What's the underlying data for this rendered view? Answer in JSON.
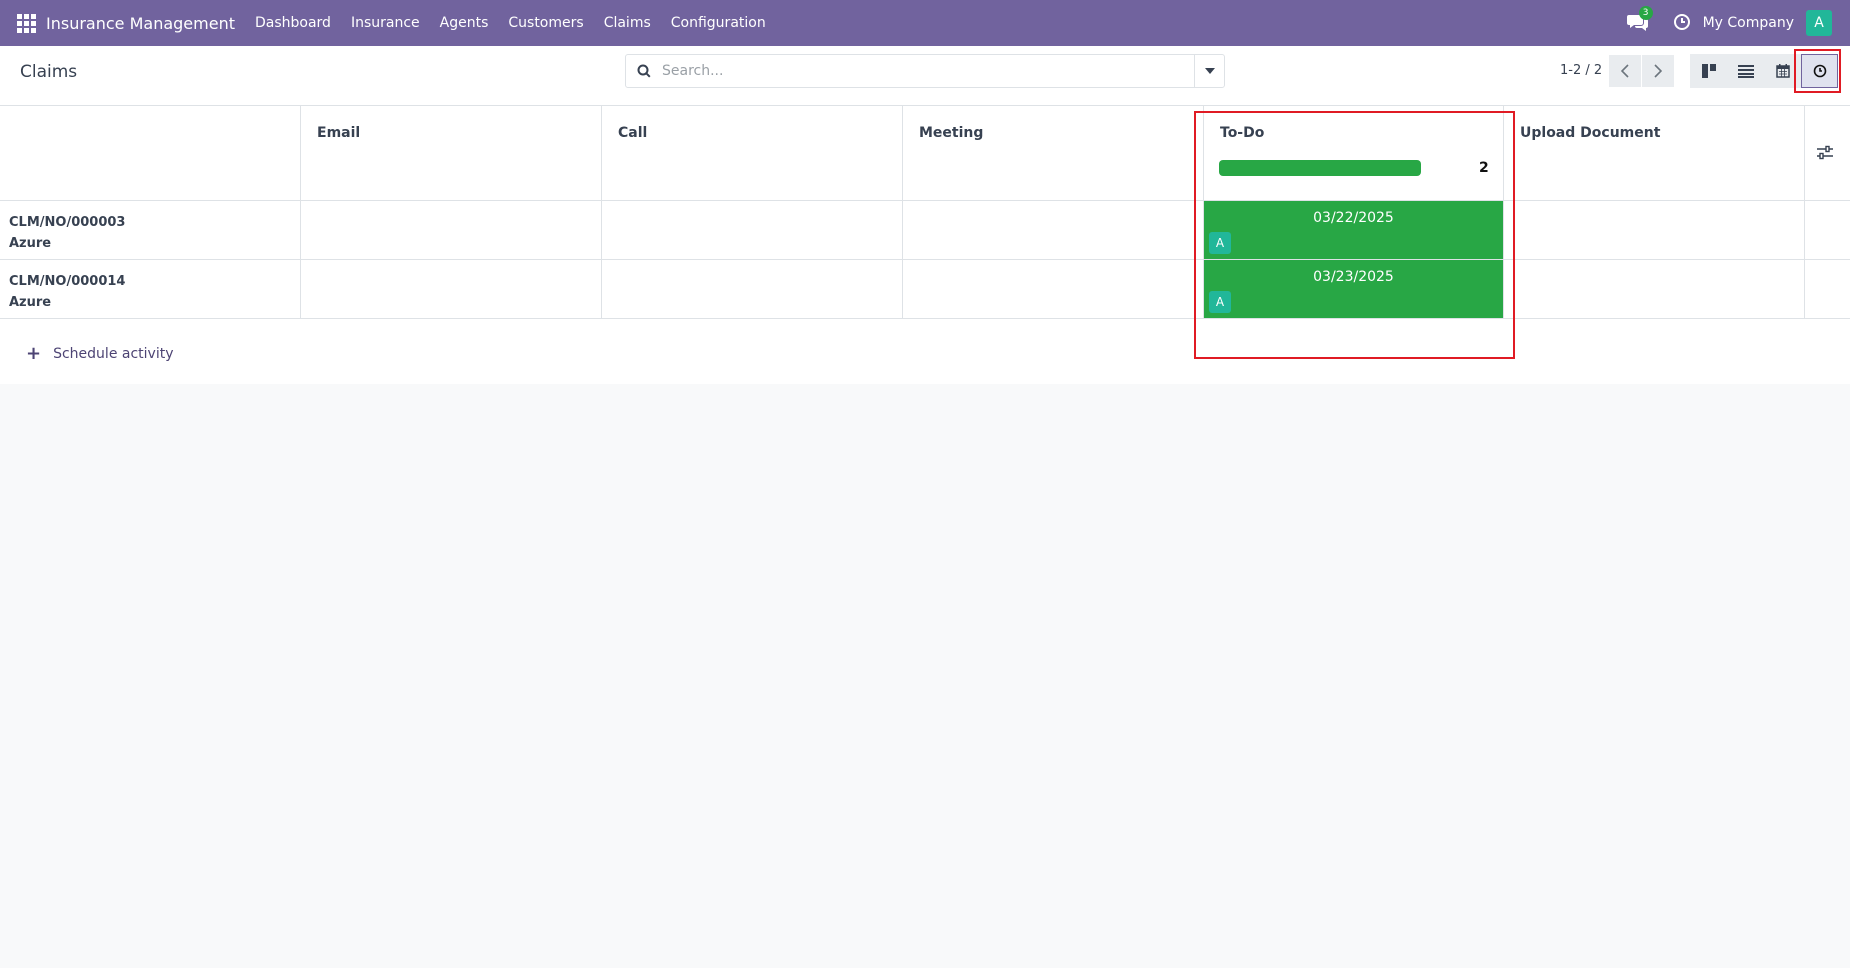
{
  "navbar": {
    "app_title": "Insurance Management",
    "menu": [
      "Dashboard",
      "Insurance",
      "Agents",
      "Customers",
      "Claims",
      "Configuration"
    ],
    "chat_badge": "3",
    "company": "My Company",
    "user_initial": "A"
  },
  "control_panel": {
    "title": "Claims",
    "search_placeholder": "Search...",
    "pager": "1-2 / 2",
    "views": [
      "kanban-view-icon",
      "list-view-icon",
      "calendar-view-icon",
      "activity-view-icon"
    ],
    "active_view": "activity-view-icon"
  },
  "activity": {
    "columns": [
      "Email",
      "Call",
      "Meeting",
      "To-Do",
      "Upload Document"
    ],
    "todo_count": "2",
    "todo_progress": 1.0,
    "rows": [
      {
        "name": "CLM/NO/000003",
        "customer": "Azure",
        "todo_date": "03/22/2025",
        "todo_avatar": "A"
      },
      {
        "name": "CLM/NO/000014",
        "customer": "Azure",
        "todo_date": "03/23/2025",
        "todo_avatar": "A"
      }
    ],
    "schedule_label": "Schedule activity"
  },
  "colors": {
    "navbar": "#71639e",
    "todo_overdue": "#28a745",
    "highlight": "#e01b24",
    "avatar": "#21b799"
  }
}
